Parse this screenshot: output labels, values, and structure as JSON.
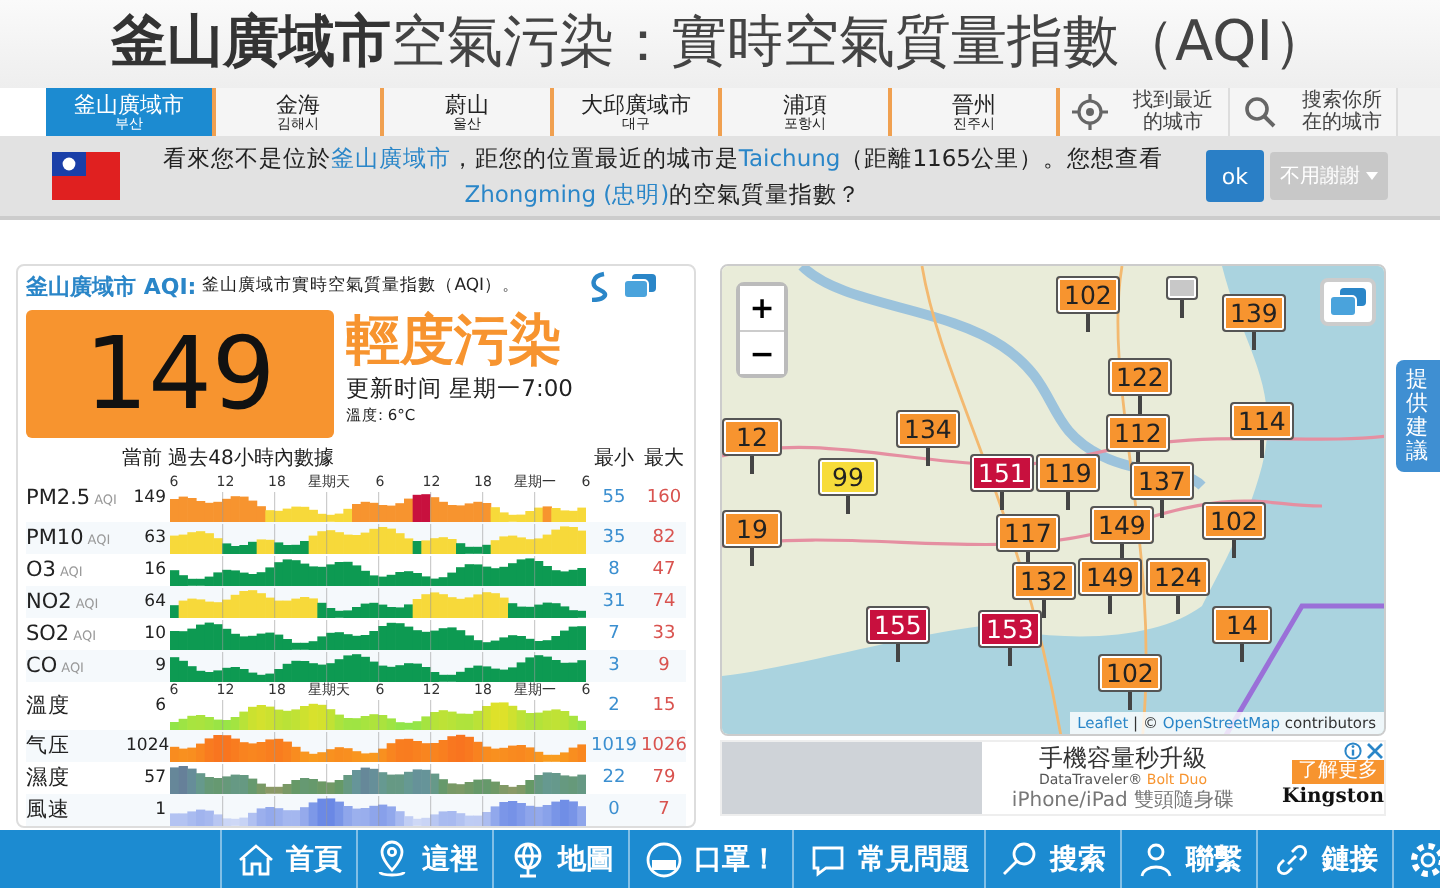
{
  "title": "**釜山廣域市**空氣污染：實時空氣質量指數（AQI）",
  "city_tabs": [
    {
      "name": "釜山廣域市",
      "local": "부산",
      "selected": true
    },
    {
      "name": "金海",
      "local": "김해시",
      "selected": false
    },
    {
      "name": "蔚山",
      "local": "울산",
      "selected": false
    },
    {
      "name": "大邱廣域市",
      "local": "대구",
      "selected": false
    },
    {
      "name": "浦項",
      "local": "포항시",
      "selected": false
    },
    {
      "name": "晉州",
      "local": "진주시",
      "selected": false
    }
  ],
  "action_tabs": [
    {
      "kind": "locate",
      "label": "找到最近的城市"
    },
    {
      "kind": "search",
      "label": "搜索你所在的城市"
    }
  ],
  "banner": {
    "parts": [
      {
        "kind": "text",
        "text": "看來您不是位於"
      },
      {
        "kind": "link",
        "text": "釜山廣域市"
      },
      {
        "kind": "text",
        "text": "，距您的位置最近的城市是"
      },
      {
        "kind": "link",
        "text": "Taichung"
      },
      {
        "kind": "text",
        "text": "（距離1165公里）。您想查看"
      },
      {
        "kind": "link",
        "text": "Zhongming (忠明)"
      },
      {
        "kind": "text",
        "text": "的空氣質量指數？"
      }
    ],
    "ok": "ok",
    "dismiss": "不用謝謝"
  },
  "aqi_card": {
    "city_link": "釜山廣域市 AQI:",
    "subtitle": "釜山廣域市實時空氣質量指數（AQI）。",
    "aqi": "149",
    "status": "輕度污染",
    "updated": "更新时间 星期一7:00",
    "temperature": "溫度: 6°C",
    "col_current": "當前 過去48小時內數據",
    "col_min": "最小",
    "col_max": "最大",
    "rows": [
      {
        "kind": "aqi",
        "name": "PM2.5",
        "unit": "AQI",
        "current": "149",
        "min": "55",
        "max": "160",
        "ticks": [
          "6",
          "12",
          "18",
          "星期天",
          "6",
          "12",
          "18",
          "星期一",
          "6"
        ]
      },
      {
        "kind": "aqi",
        "name": "PM10",
        "unit": "AQI",
        "current": "63",
        "min": "35",
        "max": "82"
      },
      {
        "kind": "aqi",
        "name": "O3",
        "unit": "AQI",
        "current": "16",
        "min": "8",
        "max": "47"
      },
      {
        "kind": "aqi",
        "name": "NO2",
        "unit": "AQI",
        "current": "64",
        "min": "31",
        "max": "74"
      },
      {
        "kind": "aqi",
        "name": "SO2",
        "unit": "AQI",
        "current": "10",
        "min": "7",
        "max": "33"
      },
      {
        "kind": "aqi",
        "name": "CO",
        "unit": "AQI",
        "current": "9",
        "min": "3",
        "max": "9"
      },
      {
        "kind": "temp",
        "name": "溫度",
        "current": "6",
        "min": "2",
        "max": "15",
        "ticks": [
          "6",
          "12",
          "18",
          "星期天",
          "6",
          "12",
          "18",
          "星期一",
          "6"
        ]
      },
      {
        "kind": "pressure",
        "name": "气压",
        "current": "1024",
        "min": "1019",
        "max": "1026"
      },
      {
        "kind": "humidity",
        "name": "濕度",
        "current": "57",
        "min": "22",
        "max": "79"
      },
      {
        "kind": "wind",
        "name": "風速",
        "current": "1",
        "min": "0",
        "max": "7"
      }
    ]
  },
  "map": {
    "zoom_in": "+",
    "zoom_out": "−",
    "markers": [
      {
        "value": "102",
        "color": "#f7942f"
      },
      {
        "color": "#c8c8c8"
      },
      {
        "value": "139",
        "color": "#f7942f"
      },
      {
        "value": "122",
        "color": "#f7942f"
      },
      {
        "value": "12",
        "color": "#f7942f"
      },
      {
        "value": "134",
        "color": "#f7942f"
      },
      {
        "value": "112",
        "color": "#f7942f"
      },
      {
        "value": "114",
        "color": "#f7942f"
      },
      {
        "value": "99",
        "color": "#f7dc3a"
      },
      {
        "value": "151",
        "color": "#c8103e"
      },
      {
        "value": "119",
        "color": "#f7942f"
      },
      {
        "value": "137",
        "color": "#f7942f"
      },
      {
        "value": "19",
        "color": "#f7942f"
      },
      {
        "value": "117",
        "color": "#f7942f"
      },
      {
        "value": "149",
        "color": "#f7942f"
      },
      {
        "value": "102",
        "color": "#f7942f"
      },
      {
        "value": "132",
        "color": "#f7942f"
      },
      {
        "value": "149",
        "color": "#f7942f"
      },
      {
        "value": "124",
        "color": "#f7942f"
      },
      {
        "value": "155",
        "color": "#c8103e"
      },
      {
        "value": "153",
        "color": "#c8103e"
      },
      {
        "value": "14",
        "color": "#f7942f"
      },
      {
        "value": "102",
        "color": "#f7942f"
      }
    ],
    "attribution": [
      {
        "kind": "link",
        "text": "Leaflet"
      },
      {
        "kind": "text",
        "text": " | © "
      },
      {
        "kind": "link",
        "text": "OpenStreetMap"
      },
      {
        "kind": "text",
        "text": " contributors"
      }
    ]
  },
  "ad": {
    "headline": "手機容量秒升級",
    "product": "DataTraveler® **Bolt Duo**",
    "tagline": "iPhone/iPad 雙頭隨身碟",
    "cta": "了解更多",
    "brand": "Kingston"
  },
  "feedback": "提供建議",
  "bottom_nav": [
    {
      "kind": "home",
      "label": "首頁"
    },
    {
      "kind": "pin",
      "label": "這裡"
    },
    {
      "kind": "globe",
      "label": "地圖"
    },
    {
      "kind": "mask",
      "label": "口罩！"
    },
    {
      "kind": "faq",
      "label": "常見問題"
    },
    {
      "kind": "search",
      "label": "搜索"
    },
    {
      "kind": "contact",
      "label": "聯繫"
    },
    {
      "kind": "link",
      "label": "鏈接"
    },
    {
      "kind": "settings"
    }
  ]
}
